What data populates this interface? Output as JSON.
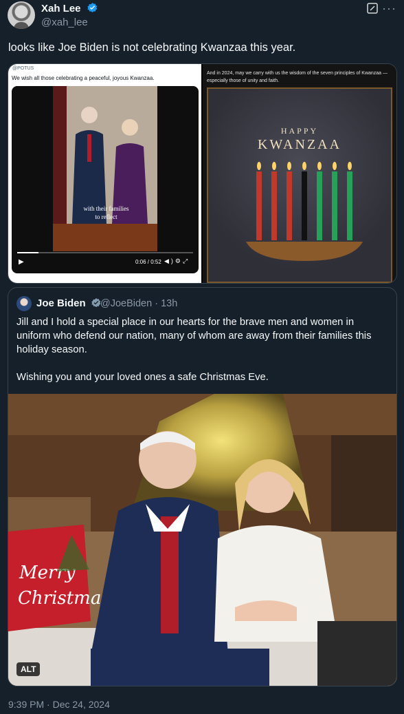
{
  "tweet": {
    "author_name": "Xah Lee",
    "author_handle": "@xah_lee",
    "text": "looks like Joe Biden is not celebrating Kwanzaa this year.",
    "timestamp": "9:39 PM · Dec 24, 2024"
  },
  "media": {
    "left": {
      "account": "@POTUS",
      "text": "We wish all those celebrating a peaceful, joyous Kwanzaa.",
      "caption_line1": "with their families",
      "caption_line2": "to reflect",
      "time": "0:06 / 0:52",
      "progress": 0.12
    },
    "right": {
      "text": "And in 2024, may we carry with us the wisdom of the seven principles of Kwanzaa — especially those of unity and faith.",
      "happy": "HAPPY",
      "title": "KWANZAA",
      "candle_colors": [
        "#c0392b",
        "#c0392b",
        "#c0392b",
        "#111111",
        "#27a05a",
        "#27a05a",
        "#27a05a"
      ]
    }
  },
  "quote": {
    "author_name": "Joe Biden",
    "handle_time": "@JoeBiden · 13h",
    "paragraph1": "Jill and I hold a special place in our hearts for the brave men and women in uniform who defend our nation, many of whom are away from their families this holiday season.",
    "paragraph2": "Wishing you and your loved ones a safe Christmas Eve.",
    "alt_label": "ALT",
    "pillow_text": "Merry Christmas"
  },
  "colors": {
    "background": "#15202b",
    "verified": "#1d9bf0",
    "muted": "#8b98a5",
    "border": "#38444d"
  }
}
